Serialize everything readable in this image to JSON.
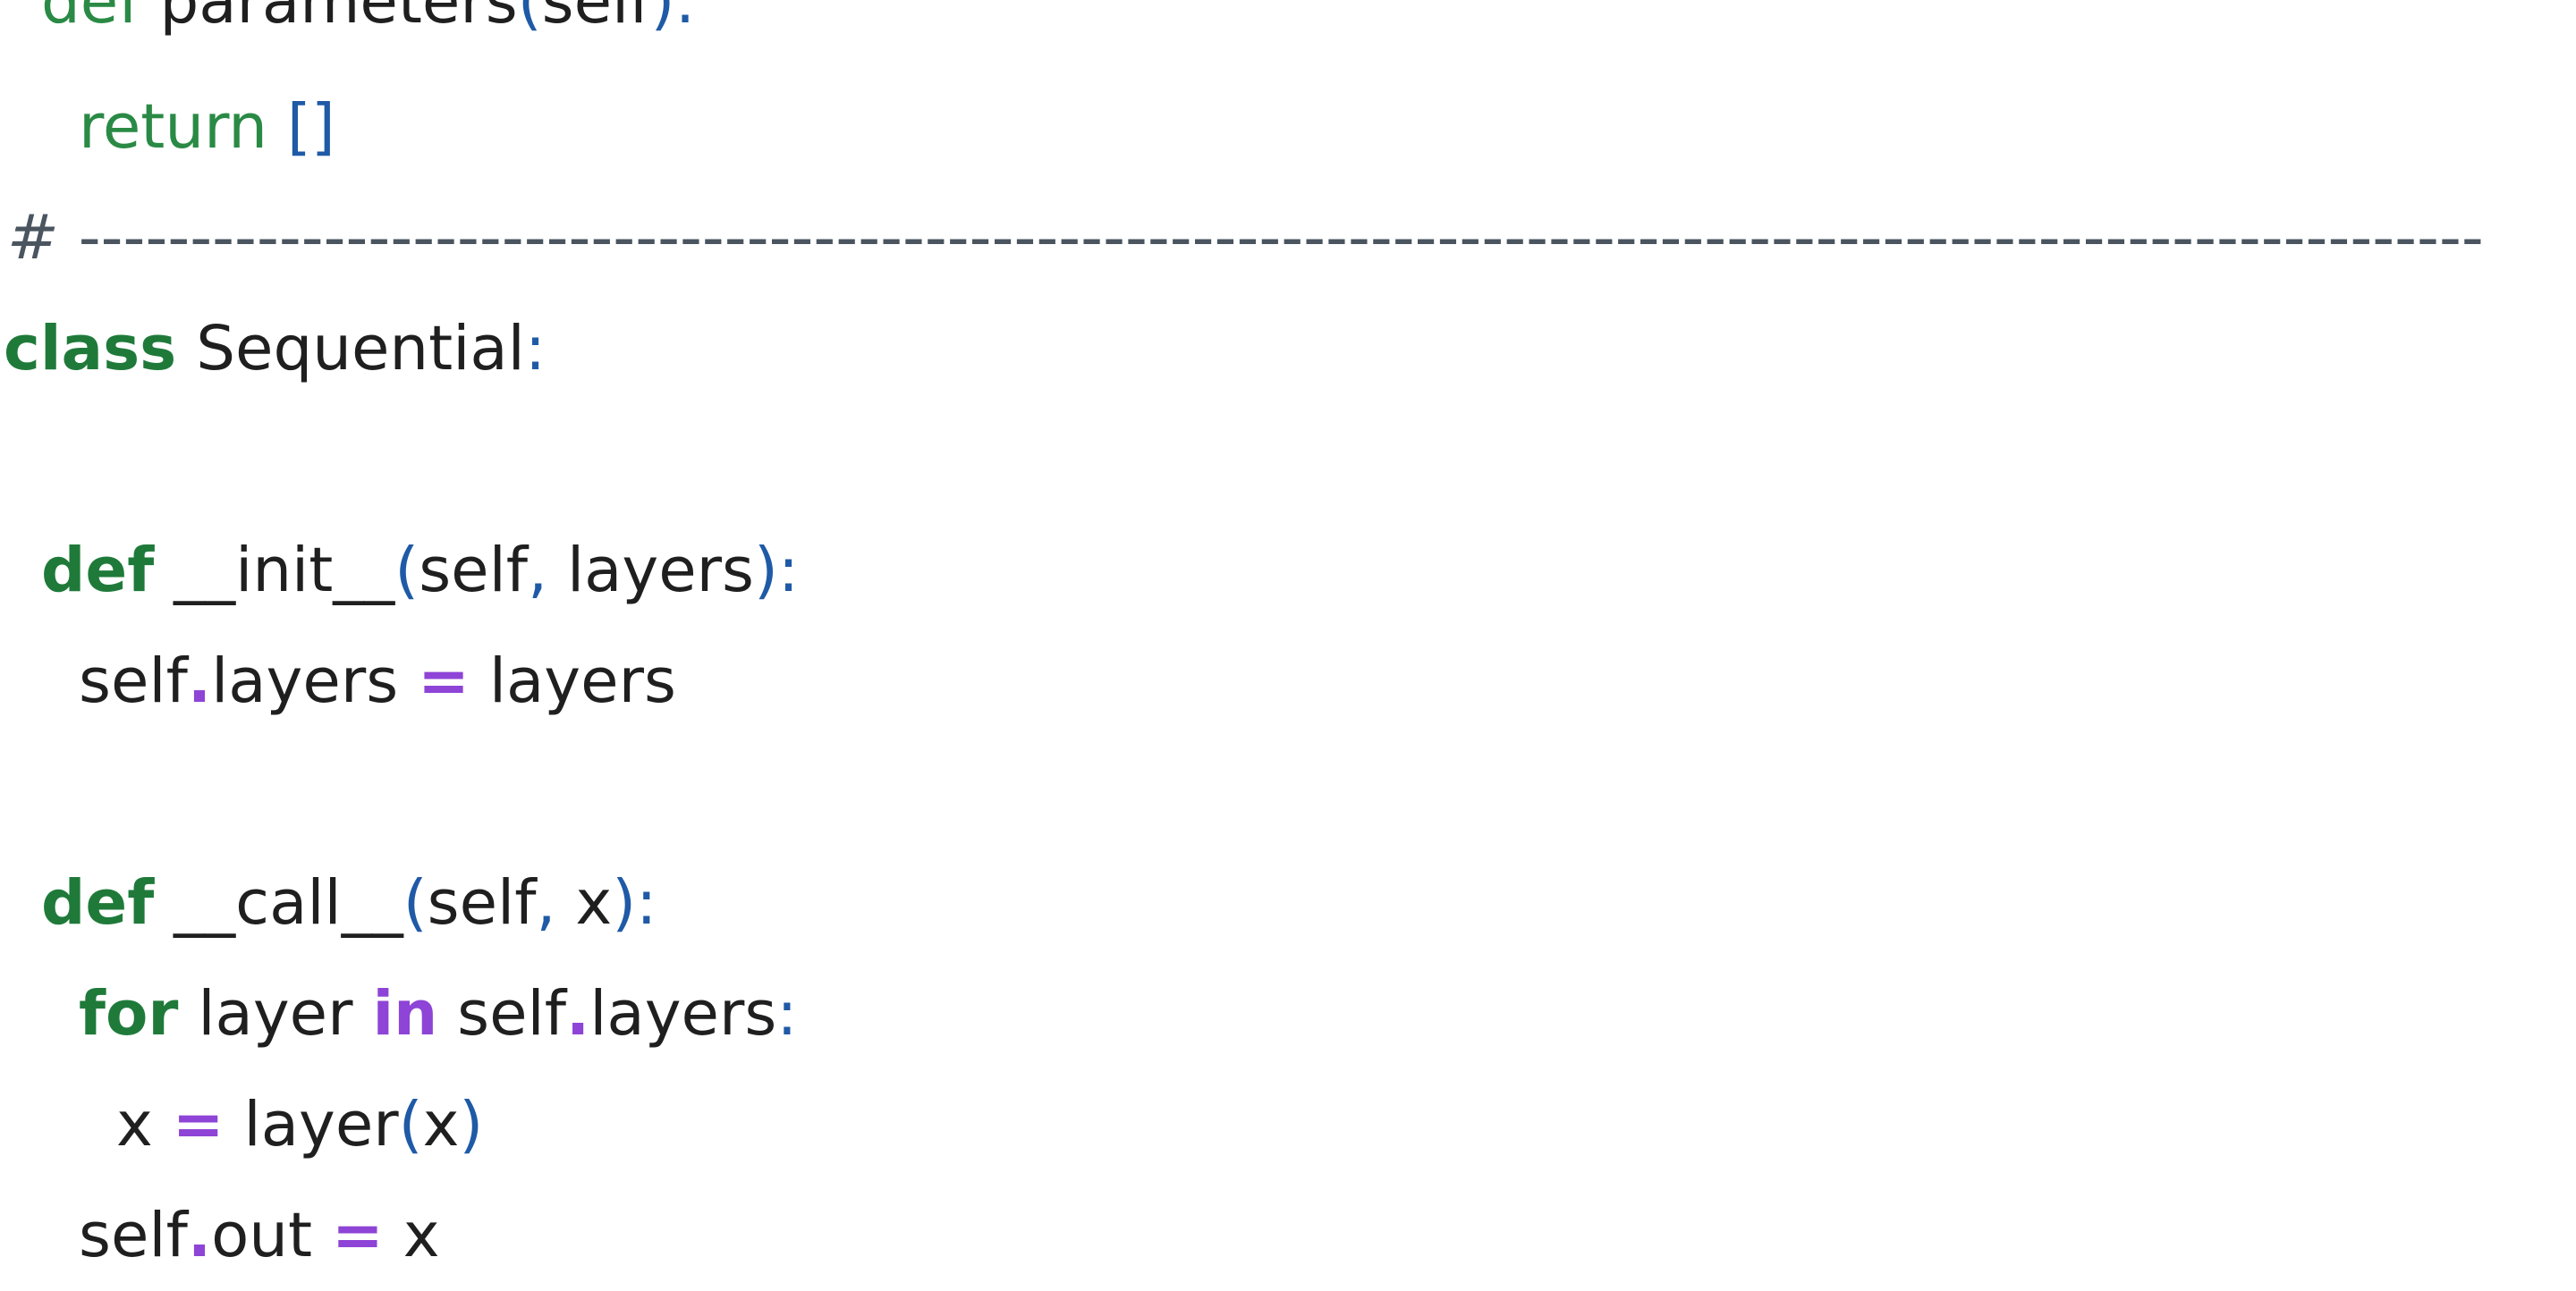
{
  "code": {
    "line1": {
      "kw": "def",
      "name": " parameters",
      "open": "(",
      "arg": "self",
      "close": "):"
    },
    "line2": {
      "kw": "return",
      "sp": " ",
      "brackets": "[]"
    },
    "line3": {
      "hash": "#",
      "rule": " ------------------------------------------------------------------------------------------------------------"
    },
    "line4": {
      "kw": "class",
      "name": " Sequential",
      "colon": ":"
    },
    "line5": {
      "kw": "def",
      "name": " __init__",
      "open": "(",
      "arg1": "self",
      "comma": ",",
      "arg2": " layers",
      "close": "):"
    },
    "line6": {
      "obj": "self",
      "dot": ".",
      "attr": "layers",
      "sp1": " ",
      "eq": "=",
      "val": " layers"
    },
    "line7": {
      "kw": "def",
      "name": " __call__",
      "open": "(",
      "arg1": "self",
      "comma": ",",
      "arg2": " x",
      "close": "):"
    },
    "line8": {
      "kw": "for",
      "var": " layer ",
      "in": "in",
      "obj": " self",
      "dot": ".",
      "attr": "layers",
      "colon": ":"
    },
    "line9": {
      "var": "x ",
      "eq": "=",
      "fn": " layer",
      "open": "(",
      "arg": "x",
      "close": ")"
    },
    "line10": {
      "obj": "self",
      "dot": ".",
      "attr": "out",
      "sp1": " ",
      "eq": "=",
      "val": " x"
    }
  }
}
